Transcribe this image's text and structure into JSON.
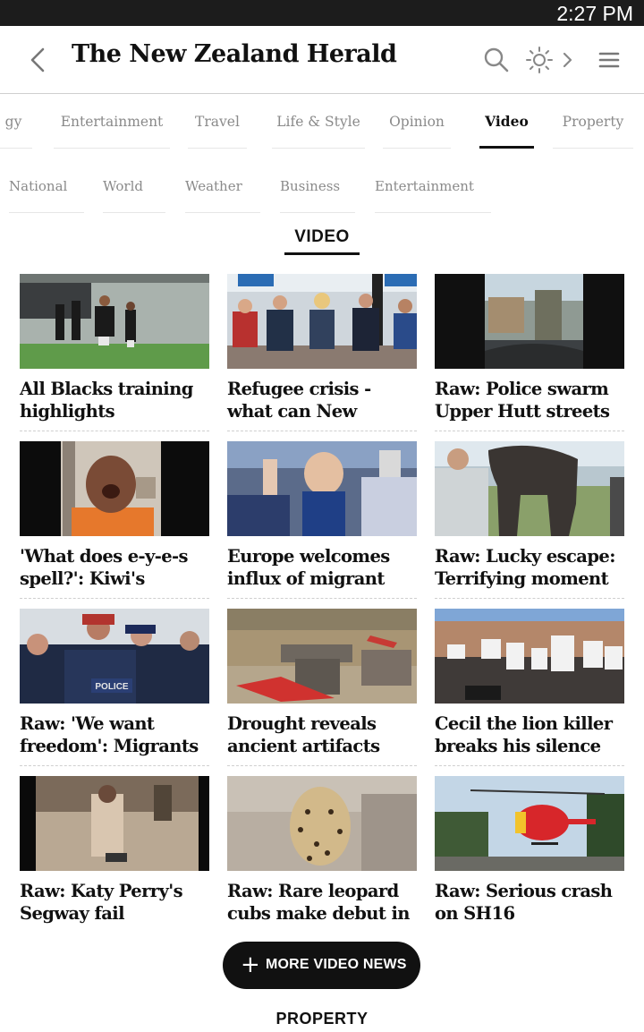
{
  "status_bar": {
    "time": "2:27 PM"
  },
  "header": {
    "logo_text": "The New Zealand Herald",
    "icons": [
      "back-chevron-icon",
      "search-icon",
      "brightness-icon",
      "chevron-right-icon",
      "hamburger-menu-icon"
    ]
  },
  "nav_primary": {
    "items": [
      {
        "label": "gy"
      },
      {
        "label": "Entertainment"
      },
      {
        "label": "Travel"
      },
      {
        "label": "Life & Style"
      },
      {
        "label": "Opinion"
      },
      {
        "label": "Video",
        "active": true
      },
      {
        "label": "Property"
      }
    ]
  },
  "nav_secondary": {
    "items": [
      {
        "label": "National"
      },
      {
        "label": "World"
      },
      {
        "label": "Weather"
      },
      {
        "label": "Business"
      },
      {
        "label": "Entertainment"
      }
    ]
  },
  "section": {
    "title": "VIDEO"
  },
  "videos": [
    {
      "line1": "All Blacks training",
      "line2": "highlights",
      "thumb": "rugby-players-thumbnail"
    },
    {
      "line1": "Refugee crisis -",
      "line2": "what can New",
      "thumb": "tv-panel-thumbnail"
    },
    {
      "line1": "Raw: Police swarm",
      "line2": "Upper Hutt streets",
      "thumb": "street-dashcam-thumbnail"
    },
    {
      "line1": "'What does e-y-e-s",
      "line2": "spell?': Kiwi's",
      "thumb": "laughing-man-thumbnail"
    },
    {
      "line1": "Europe welcomes",
      "line2": "influx of migrant",
      "thumb": "migrant-child-thumbnail"
    },
    {
      "line1": "Raw: Lucky escape:",
      "line2": "Terrifying moment",
      "thumb": "elephant-thumbnail"
    },
    {
      "line1": "Raw: 'We want",
      "line2": "freedom': Migrants",
      "thumb": "police-crowd-thumbnail",
      "badge": "POLICE"
    },
    {
      "line1": "Drought reveals",
      "line2": "ancient artifacts",
      "thumb": "ancient-artifact-thumbnail"
    },
    {
      "line1": "Cecil the lion killer",
      "line2": "breaks his silence",
      "thumb": "protest-signs-thumbnail"
    },
    {
      "line1": "Raw: Katy Perry's",
      "line2": "Segway fail",
      "thumb": "segway-thumbnail"
    },
    {
      "line1": "Raw: Rare leopard",
      "line2": "cubs make debut in",
      "thumb": "leopard-cub-thumbnail"
    },
    {
      "line1": "Raw: Serious crash",
      "line2": "on SH16",
      "thumb": "rescue-helicopter-thumbnail"
    }
  ],
  "more_button": {
    "label": "MORE VIDEO NEWS"
  },
  "next_section": {
    "title": "PROPERTY"
  },
  "colors": {
    "text": "#111111",
    "muted": "#8a8a8a",
    "statusbar": "#1c1c1c",
    "button": "#111111"
  }
}
